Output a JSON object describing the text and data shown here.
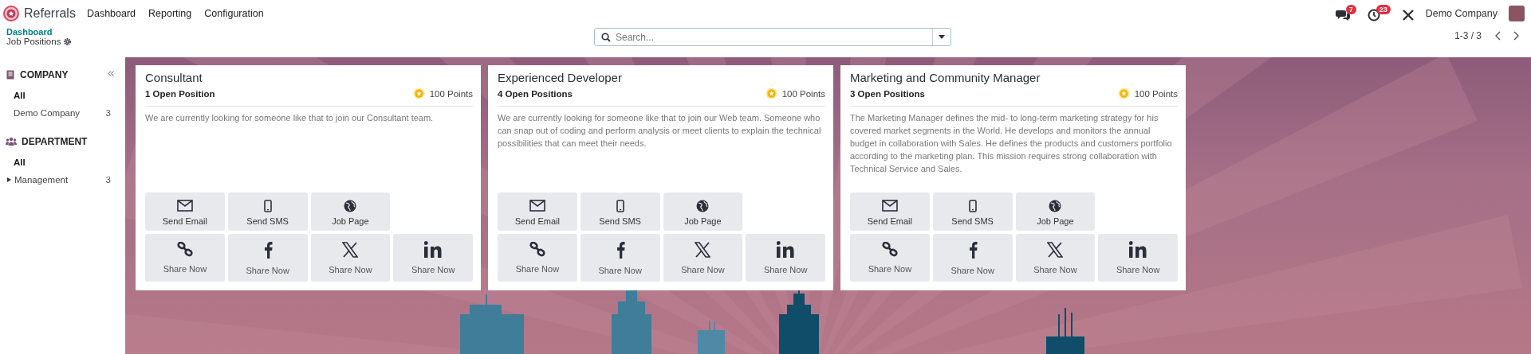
{
  "app": {
    "name": "Referrals"
  },
  "menu": [
    {
      "label": "Dashboard"
    },
    {
      "label": "Reporting"
    },
    {
      "label": "Configuration"
    }
  ],
  "systray": {
    "messages_badge": "7",
    "activities_badge": "23",
    "company": "Demo Company"
  },
  "breadcrumb": {
    "parent": "Dashboard",
    "current": "Job Positions"
  },
  "search": {
    "placeholder": "Search..."
  },
  "pager": {
    "value": "1-3 / 3"
  },
  "sidebar": {
    "sections": [
      {
        "title": "COMPANY",
        "kind": "company",
        "items": [
          {
            "label": "All",
            "selected": true,
            "kind": "plain"
          },
          {
            "label": "Demo Company",
            "count": "3",
            "selected": false,
            "kind": "plain"
          }
        ]
      },
      {
        "title": "DEPARTMENT",
        "kind": "department",
        "items": [
          {
            "label": "All",
            "selected": true,
            "kind": "plain"
          },
          {
            "label": "Management",
            "count": "3",
            "selected": false,
            "kind": "folder",
            "expanded": false
          }
        ]
      }
    ]
  },
  "cards": [
    {
      "title": "Consultant",
      "positions": "1 Open Position",
      "points": "100 Points",
      "description": "We are currently looking for someone like that to join our Consultant team.",
      "contact_actions": [
        {
          "kind": "email",
          "label": "Send Email"
        },
        {
          "kind": "sms",
          "label": "Send SMS"
        },
        {
          "kind": "web",
          "label": "Job Page"
        }
      ],
      "share_actions": [
        {
          "kind": "link",
          "label": "Share Now"
        },
        {
          "kind": "facebook",
          "label": "Share Now"
        },
        {
          "kind": "x",
          "label": "Share Now"
        },
        {
          "kind": "linkedin",
          "label": "Share Now"
        }
      ]
    },
    {
      "title": "Experienced Developer",
      "positions": "4 Open Positions",
      "points": "100 Points",
      "description": "We are currently looking for someone like that to join our Web team. Someone who can snap out of coding and perform analysis or meet clients to explain the technical possibilities that can meet their needs.",
      "contact_actions": [
        {
          "kind": "email",
          "label": "Send Email"
        },
        {
          "kind": "sms",
          "label": "Send SMS"
        },
        {
          "kind": "web",
          "label": "Job Page"
        }
      ],
      "share_actions": [
        {
          "kind": "link",
          "label": "Share Now"
        },
        {
          "kind": "facebook",
          "label": "Share Now"
        },
        {
          "kind": "x",
          "label": "Share Now"
        },
        {
          "kind": "linkedin",
          "label": "Share Now"
        }
      ]
    },
    {
      "title": "Marketing and Community Manager",
      "positions": "3 Open Positions",
      "points": "100 Points",
      "description": "The Marketing Manager defines the mid- to long-term marketing strategy for his covered market segments in the World. He develops and monitors the annual budget in collaboration with Sales. He defines the products and customers portfolio according to the marketing plan. This mission requires strong collaboration with Technical Service and Sales.",
      "contact_actions": [
        {
          "kind": "email",
          "label": "Send Email"
        },
        {
          "kind": "sms",
          "label": "Send SMS"
        },
        {
          "kind": "web",
          "label": "Job Page"
        }
      ],
      "share_actions": [
        {
          "kind": "link",
          "label": "Share Now"
        },
        {
          "kind": "facebook",
          "label": "Share Now"
        },
        {
          "kind": "x",
          "label": "Share Now"
        },
        {
          "kind": "linkedin",
          "label": "Share Now"
        }
      ]
    }
  ]
}
